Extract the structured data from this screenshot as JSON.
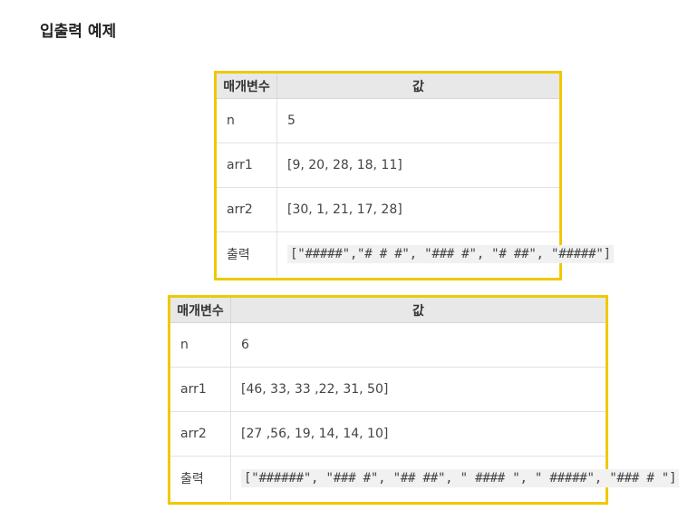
{
  "title": "입출력 예제",
  "headers": {
    "param": "매개변수",
    "value": "값"
  },
  "examples": [
    {
      "rows": [
        {
          "name": "n",
          "value": "5"
        },
        {
          "name": "arr1",
          "value": "[9, 20, 28, 18, 11]"
        },
        {
          "name": "arr2",
          "value": "[30, 1, 21, 17, 28]"
        },
        {
          "name": "출력",
          "value": "[\"#####\",\"# # #\", \"### #\", \"# ##\", \"#####\"]"
        }
      ]
    },
    {
      "rows": [
        {
          "name": "n",
          "value": "6"
        },
        {
          "name": "arr1",
          "value": "[46, 33, 33 ,22, 31, 50]"
        },
        {
          "name": "arr2",
          "value": "[27 ,56, 19, 14, 14, 10]"
        },
        {
          "name": "출력",
          "value": "[\"######\", \"### #\", \"## ##\", \" #### \", \" #####\", \"### # \"]"
        }
      ]
    }
  ]
}
